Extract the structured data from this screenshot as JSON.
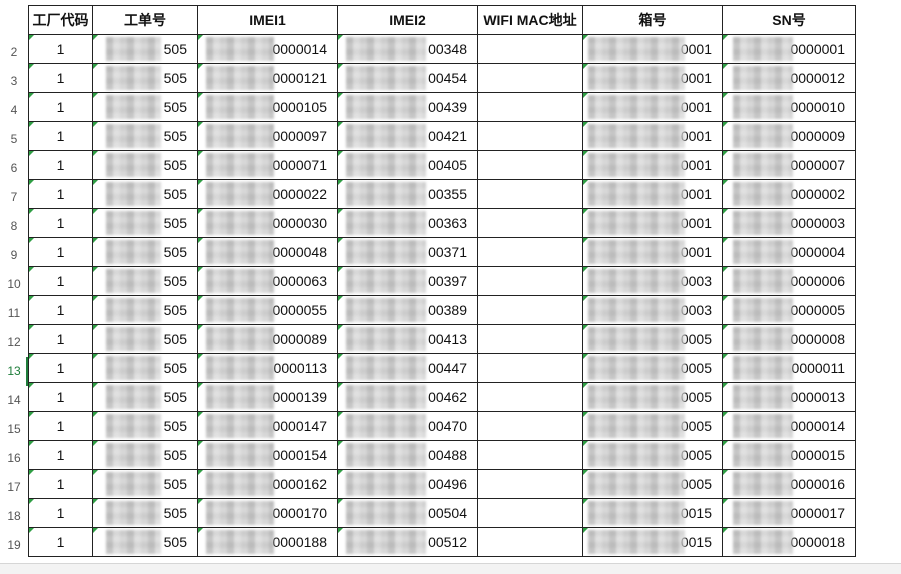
{
  "headers": {
    "factory_code": "工厂代码",
    "work_order": "工单号",
    "imei1": "IMEI1",
    "imei2": "IMEI2",
    "wifi_mac": "WIFI MAC地址",
    "box_no": "箱号",
    "sn": "SN号"
  },
  "active_row": "13",
  "rows": [
    {
      "row": "2",
      "factory": "1",
      "order": "505",
      "imei1": "0000014",
      "imei2": "00348",
      "wifi": "",
      "box": "0001",
      "sn": "0000001"
    },
    {
      "row": "3",
      "factory": "1",
      "order": "505",
      "imei1": "0000121",
      "imei2": "00454",
      "wifi": "",
      "box": "0001",
      "sn": "0000012"
    },
    {
      "row": "4",
      "factory": "1",
      "order": "505",
      "imei1": "0000105",
      "imei2": "00439",
      "wifi": "",
      "box": "0001",
      "sn": "0000010"
    },
    {
      "row": "5",
      "factory": "1",
      "order": "505",
      "imei1": "0000097",
      "imei2": "00421",
      "wifi": "",
      "box": "0001",
      "sn": "0000009"
    },
    {
      "row": "6",
      "factory": "1",
      "order": "505",
      "imei1": "0000071",
      "imei2": "00405",
      "wifi": "",
      "box": "0001",
      "sn": "0000007"
    },
    {
      "row": "7",
      "factory": "1",
      "order": "505",
      "imei1": "0000022",
      "imei2": "00355",
      "wifi": "",
      "box": "0001",
      "sn": "0000002"
    },
    {
      "row": "8",
      "factory": "1",
      "order": "505",
      "imei1": "0000030",
      "imei2": "00363",
      "wifi": "",
      "box": "0001",
      "sn": "0000003"
    },
    {
      "row": "9",
      "factory": "1",
      "order": "505",
      "imei1": "0000048",
      "imei2": "00371",
      "wifi": "",
      "box": "0001",
      "sn": "0000004"
    },
    {
      "row": "10",
      "factory": "1",
      "order": "505",
      "imei1": "0000063",
      "imei2": "00397",
      "wifi": "",
      "box": "0003",
      "sn": "0000006"
    },
    {
      "row": "11",
      "factory": "1",
      "order": "505",
      "imei1": "0000055",
      "imei2": "00389",
      "wifi": "",
      "box": "0003",
      "sn": "0000005"
    },
    {
      "row": "12",
      "factory": "1",
      "order": "505",
      "imei1": "0000089",
      "imei2": "00413",
      "wifi": "",
      "box": "0005",
      "sn": "0000008"
    },
    {
      "row": "13",
      "factory": "1",
      "order": "505",
      "imei1": "0000113",
      "imei2": "00447",
      "wifi": "",
      "box": "0005",
      "sn": "0000011"
    },
    {
      "row": "14",
      "factory": "1",
      "order": "505",
      "imei1": "0000139",
      "imei2": "00462",
      "wifi": "",
      "box": "0005",
      "sn": "0000013"
    },
    {
      "row": "15",
      "factory": "1",
      "order": "505",
      "imei1": "0000147",
      "imei2": "00470",
      "wifi": "",
      "box": "0005",
      "sn": "0000014"
    },
    {
      "row": "16",
      "factory": "1",
      "order": "505",
      "imei1": "0000154",
      "imei2": "00488",
      "wifi": "",
      "box": "0005",
      "sn": "0000015"
    },
    {
      "row": "17",
      "factory": "1",
      "order": "505",
      "imei1": "0000162",
      "imei2": "00496",
      "wifi": "",
      "box": "0005",
      "sn": "0000016"
    },
    {
      "row": "18",
      "factory": "1",
      "order": "505",
      "imei1": "0000170",
      "imei2": "00504",
      "wifi": "",
      "box": "0015",
      "sn": "0000017"
    },
    {
      "row": "19",
      "factory": "1",
      "order": "505",
      "imei1": "0000188",
      "imei2": "00512",
      "wifi": "",
      "box": "0015",
      "sn": "0000018"
    }
  ]
}
